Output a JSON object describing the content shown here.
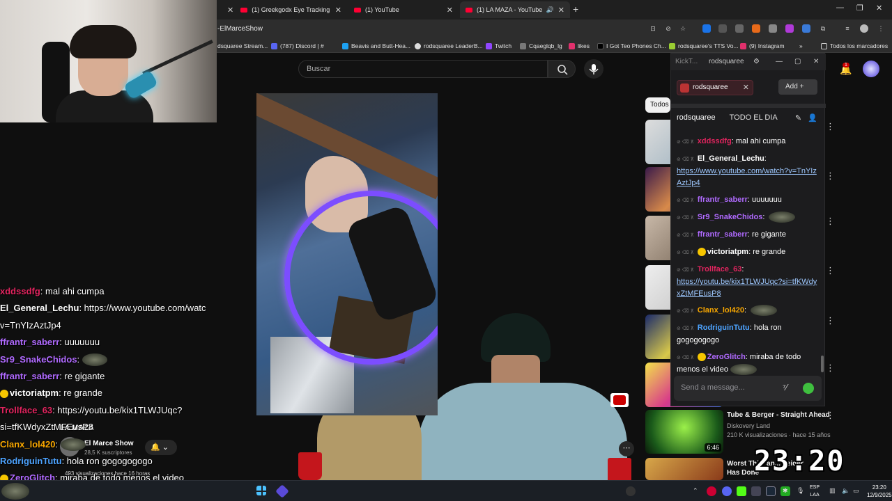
{
  "browser": {
    "tabs": [
      {
        "title": "(1) Greekgodx Eye Tracking Ch..."
      },
      {
        "title": "(1) YouTube"
      },
      {
        "title": "(1) LA MAZA - YouTube"
      }
    ],
    "address_text": "-ElMarceShow",
    "bookmarks": [
      "dsquaree Stream...",
      "(787) Discord | #",
      "Beavis and Butt-Hea...",
      "rodsquaree LeaderB...",
      "Twitch",
      "Cqaeglqb_lg",
      "likes",
      "I Got Teo Phones Ch...",
      "rodsquaree's TTS Vo...",
      "(9) Instagram",
      "Todos los marcadores"
    ]
  },
  "youtube": {
    "search_placeholder": "Buscar",
    "notification_count": "1",
    "filter_chip": "Todos",
    "video_title": "LA MAZA",
    "channel_name": "El Marce Show",
    "channel_subs": "28,5 K suscriptores",
    "view_info": "493 visualizaciones  hace 16 horas",
    "recommendation": {
      "title": "Tube & Berger - Straight Ahead",
      "channel": "Diskovery Land",
      "meta": "210 K visualizaciones · hace 15 años",
      "duration": "6:46"
    },
    "recommendation2_title": "Worst Thi... an... neider Has Done"
  },
  "overlay_clock": "23:20",
  "overlay_chat": [
    {
      "user": "xddssdfg",
      "color": "#e0245e",
      "text": ": mal ahi cumpa"
    },
    {
      "user": "El_General_Lechu",
      "color": "#ffffff",
      "text": ": https://www.youtube.com/watc"
    },
    {
      "user": "",
      "color": "#ffffff",
      "text": "v=TnYIzAztJp4"
    },
    {
      "user": "ffrantr_saberr",
      "color": "#b06aff",
      "text": ": uuuuuuu"
    },
    {
      "user": "Sr9_SnakeChidos",
      "color": "#b06aff",
      "text": ":",
      "emote": true
    },
    {
      "user": "ffrantr_saberr",
      "color": "#b06aff",
      "text": ": re gigante"
    },
    {
      "user": "victoriatpm",
      "color": "#ffffff",
      "text": ": re grande"
    },
    {
      "user": "Trollface_63",
      "color": "#e0245e",
      "text": ": https://youtu.be/kix1TLWJUqc?"
    },
    {
      "user": "",
      "color": "#ffffff",
      "text": "si=tfKWdyxZtMFEusP8"
    },
    {
      "user": "Clanx_lol420",
      "color": "#f7a600",
      "text": ":",
      "emote": true
    },
    {
      "user": "RodriguinTutu",
      "color": "#4da3ff",
      "text": ": hola ron gogogogogo"
    },
    {
      "user": "ZeroGlitch",
      "color": "#b06aff",
      "text": ": miraba de todo menos el video"
    }
  ],
  "kicktalk": {
    "tab_label": "KickT...",
    "window_title": "rodsquaree",
    "channel_chip": "rodsquaree",
    "add_label": "Add",
    "header_channel": "rodsquaree",
    "header_title": "TODO EL DIA",
    "input_placeholder": "Send a message...",
    "messages": [
      {
        "user": "xddssdfg",
        "color": "#e0245e",
        "text": "mal ahi cumpa"
      },
      {
        "user": "El_General_Lechu",
        "color": "#ffffff",
        "text": "",
        "link": "https://www.youtube.com/watch?v=TnYIzAztJp4"
      },
      {
        "user": "ffrantr_saberr",
        "color": "#b06aff",
        "text": "uuuuuuu"
      },
      {
        "user": "Sr9_SnakeChidos",
        "color": "#b06aff",
        "text": "",
        "emote": true
      },
      {
        "user": "ffrantr_saberr",
        "color": "#b06aff",
        "text": "re gigante"
      },
      {
        "user": "victoriatpm",
        "color": "#ffffff",
        "text": "re grande"
      },
      {
        "user": "Trollface_63",
        "color": "#e0245e",
        "text": "",
        "link": "https://youtu.be/kix1TLWJUqc?si=tfKWdyxZtMFEusP8"
      },
      {
        "user": "Clanx_lol420",
        "color": "#f7a600",
        "text": "",
        "emote": true
      },
      {
        "user": "RodriguinTutu",
        "color": "#4da3ff",
        "text": "hola ron gogogogogo"
      },
      {
        "user": "ZeroGlitch",
        "color": "#b06aff",
        "text": "miraba de todo menos el video",
        "emote": true
      }
    ]
  },
  "taskbar": {
    "lang_top": "ESP",
    "lang_bottom": "LAA",
    "time": "23:20",
    "date": "12/9/2025"
  }
}
